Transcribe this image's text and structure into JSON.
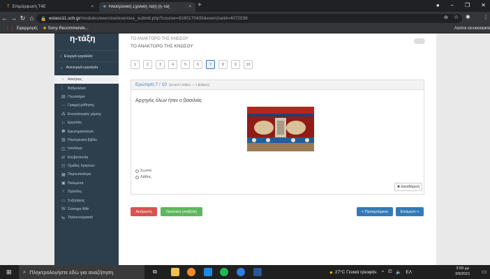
{
  "browser": {
    "tabs": [
      {
        "label": "Επιμόρφωση T4E",
        "close": "×"
      },
      {
        "label": "Ηλεκτρονική Σχολική Τάξη (η-Τάξ",
        "close": "×"
      }
    ],
    "newtab": "+",
    "url_domain": "eclass11.sch.gr",
    "url_path": "/modules/exercise/exercise_submit.php?course=9190170435&exerciseId=4072038",
    "bookmarks": {
      "apps": "Εφαρμογές",
      "sony": "Sony-Recommende...",
      "other": "Λοιποί σελιδοδείκτες"
    }
  },
  "sidebar": {
    "logo": "η-τάξη",
    "sections": {
      "active_tools": "Ενεργά εργαλεία",
      "inactive_tools": "Ανενεργά εργαλεία"
    },
    "items": [
      {
        "label": "Ασκήσεις",
        "icon": "pencil-icon"
      },
      {
        "label": "Βαθμολόγιο",
        "icon": "grades-icon"
      },
      {
        "label": "Γλωσσάριο",
        "icon": "glossary-icon"
      },
      {
        "label": "Γραμμή μάθησης",
        "icon": "learning-path-icon"
      },
      {
        "label": "Εννοιολογικός χάρτης",
        "icon": "mindmap-icon"
      },
      {
        "label": "Εργασίες",
        "icon": "assignments-icon"
      },
      {
        "label": "Ερωτηματολόγια",
        "icon": "questionnaire-icon"
      },
      {
        "label": "Ηλεκτρονικό βιβλίο",
        "icon": "ebook-icon"
      },
      {
        "label": "Ιστολόγιο",
        "icon": "blog-icon"
      },
      {
        "label": "Κουβεντούλα",
        "icon": "chat-icon"
      },
      {
        "label": "Ομάδες Χρηστών",
        "icon": "groups-icon"
      },
      {
        "label": "Παρουσιολόγιο",
        "icon": "attendance-icon"
      },
      {
        "label": "Πολυμέσα",
        "icon": "multimedia-icon"
      },
      {
        "label": "Πρόοδος",
        "icon": "progress-icon"
      },
      {
        "label": "Συζητήσεις",
        "icon": "forum-icon"
      },
      {
        "label": "Σύστημα Wiki",
        "icon": "wiki-icon"
      },
      {
        "label": "Τηλεσυνεργασία",
        "icon": "teleconference-icon"
      }
    ]
  },
  "main": {
    "course_line1": "ΤΟ ΑΝΑΚΤΟΡΟ ΤΗΣ ΚΝΩΣΟΥ",
    "course_line2": "ΤΟ ΑΝΑΚΤΟΡΟ ΤΗΣ ΚΝΩΣΟΥ",
    "question_numbers": [
      "1",
      "2",
      "3",
      "4",
      "5",
      "6",
      "7",
      "8",
      "9",
      "10"
    ],
    "current_question": "7",
    "question_header": "Ερώτηση 7 / 10",
    "question_meta": "(Σωστό / Λάθος — 1 βαθμός)",
    "question_text": "Αρχηγός όλων ήταν ο βασιλιάς",
    "options": [
      "Σωστό",
      "Λάθος"
    ],
    "clear_button": "✖ Εκκαθάριση",
    "cancel_button": "Ακύρωση",
    "submit_button": "Οριστική υποβολή",
    "prev_button": "< Προηγούμενο",
    "next_button": "Επόμενο >",
    "colors": {
      "cancel": "#d9534f",
      "submit": "#5cb85c",
      "nav": "#337ab7"
    }
  },
  "taskbar": {
    "search_placeholder": "Πληκτρολογήστε εδώ για αναζήτηση",
    "weather": "27°C Γενικά ηλιοφάν.",
    "lang": "ΕΛ",
    "time": "3:59 μμ",
    "date": "3/6/2021"
  }
}
